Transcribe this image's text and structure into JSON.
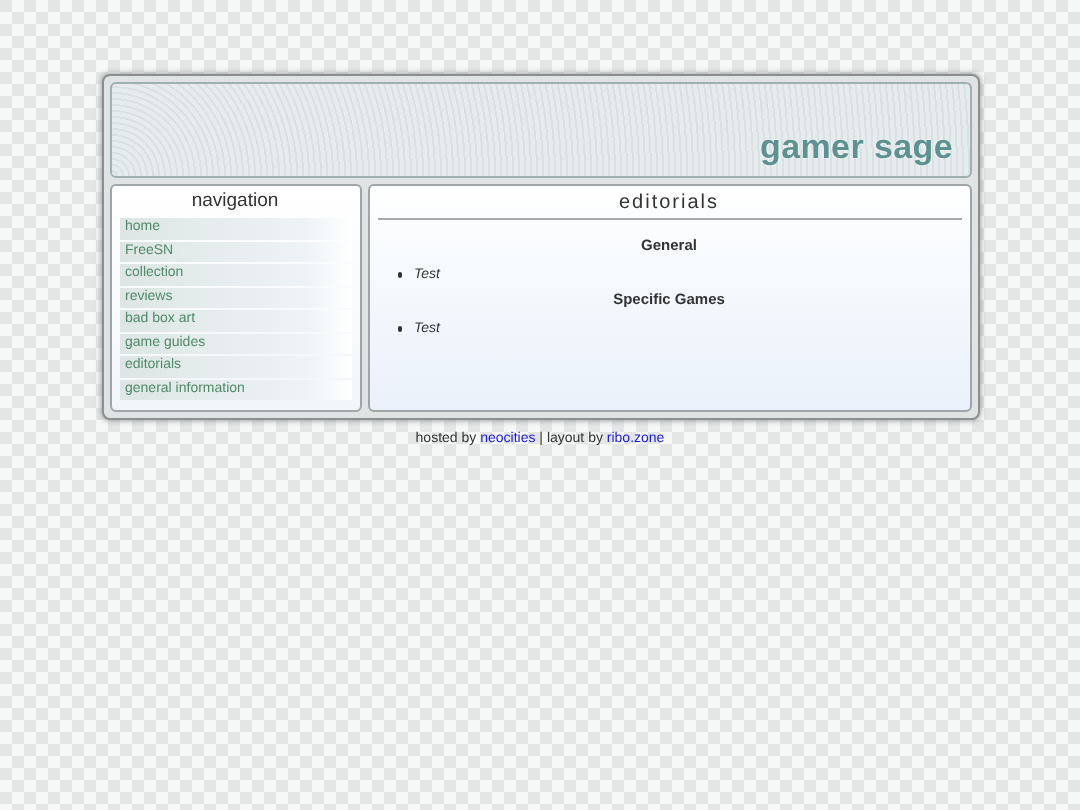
{
  "site_title": "gamer sage",
  "navigation": {
    "title": "navigation",
    "items": [
      {
        "label": "home"
      },
      {
        "label": "FreeSN"
      },
      {
        "label": "collection"
      },
      {
        "label": "reviews"
      },
      {
        "label": "bad box art"
      },
      {
        "label": "game guides"
      },
      {
        "label": "editorials"
      },
      {
        "label": "general information"
      }
    ]
  },
  "content": {
    "title": "editorials",
    "sections": [
      {
        "heading": "General",
        "items": [
          "Test"
        ]
      },
      {
        "heading": "Specific Games",
        "items": [
          "Test"
        ]
      }
    ]
  },
  "footer": [
    {
      "kind": "text",
      "text": "hosted by "
    },
    {
      "kind": "link",
      "text": "neocities"
    },
    {
      "kind": "text",
      "text": " | layout by "
    },
    {
      "kind": "link",
      "text": "ribo.zone"
    }
  ]
}
